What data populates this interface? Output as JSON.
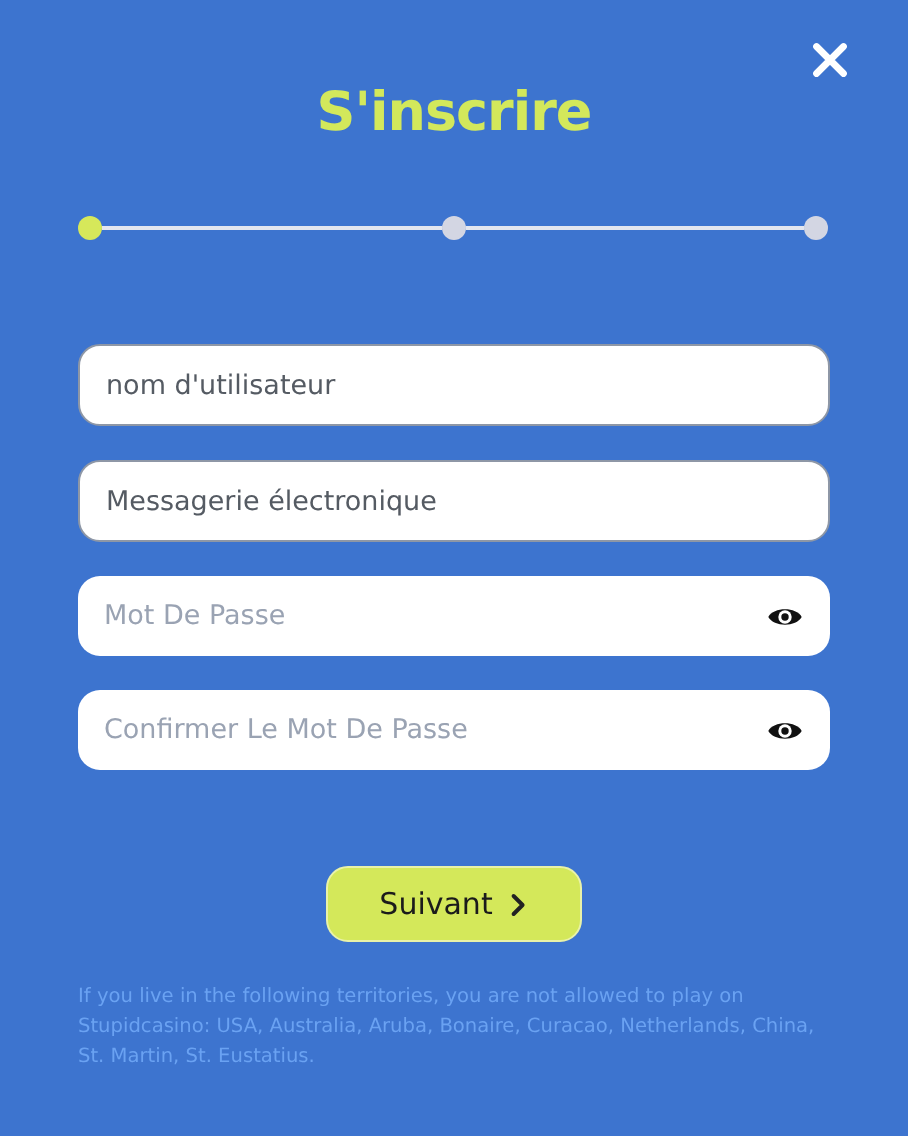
{
  "dialog": {
    "title": "S'inscrire"
  },
  "steps": [
    {
      "selected": true
    },
    {
      "selected": false
    },
    {
      "selected": false
    }
  ],
  "fields": [
    {
      "kind": "text",
      "placeholder": "nom d'utilisateur"
    },
    {
      "kind": "text",
      "placeholder": "Messagerie électronique"
    },
    {
      "kind": "password",
      "placeholder": "Mot De Passe"
    },
    {
      "kind": "password",
      "placeholder": "Confirmer Le Mot De Passe"
    }
  ],
  "next_button": {
    "label": "Suivant"
  },
  "notice": "If you live in the following territories, you are not allowed to play on Stupidcasino: USA, Australia, Aruba, Bonaire, Curacao, Netherlands, China, St. Martin, St. Eustatius."
}
